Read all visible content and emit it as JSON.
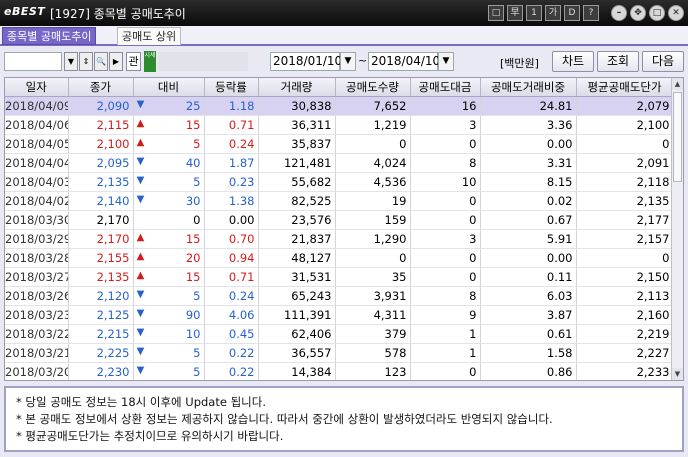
{
  "window": {
    "logo": "eBEST",
    "title": "[1927] 종목별 공매도추이",
    "buttons": [
      "□",
      "早",
      "1",
      "가",
      "D",
      "?"
    ]
  },
  "tabs": [
    {
      "label": "종목별 공매도추이",
      "active": true
    },
    {
      "label": "공매도 상위",
      "active": false
    }
  ],
  "toolbar": {
    "stock_code": "",
    "gwan_label": "관",
    "green_label": "시세",
    "date_from": "2018/01/10",
    "date_to": "2018/04/10",
    "tilde": "~",
    "unit": "[백만원]",
    "chart_button": "차트",
    "search_button": "조회",
    "next_button": "다음"
  },
  "table": {
    "columns": [
      "일자",
      "종가",
      "대비",
      "등락률",
      "거래량",
      "공매도수량",
      "공매도대금",
      "공매도거래비중",
      "평균공매도단가"
    ],
    "rows": [
      {
        "date": "2018/04/09",
        "close": "2,090",
        "dir": "down",
        "change": "25",
        "rate": "1.18",
        "volume": "30,838",
        "short_qty": "7,652",
        "short_amt": "16",
        "short_ratio": "24.81",
        "avg_price": "2,079"
      },
      {
        "date": "2018/04/06",
        "close": "2,115",
        "dir": "up",
        "change": "15",
        "rate": "0.71",
        "volume": "36,311",
        "short_qty": "1,219",
        "short_amt": "3",
        "short_ratio": "3.36",
        "avg_price": "2,100"
      },
      {
        "date": "2018/04/05",
        "close": "2,100",
        "dir": "up",
        "change": "5",
        "rate": "0.24",
        "volume": "35,837",
        "short_qty": "0",
        "short_amt": "0",
        "short_ratio": "0.00",
        "avg_price": "0"
      },
      {
        "date": "2018/04/04",
        "close": "2,095",
        "dir": "down",
        "change": "40",
        "rate": "1.87",
        "volume": "121,481",
        "short_qty": "4,024",
        "short_amt": "8",
        "short_ratio": "3.31",
        "avg_price": "2,091"
      },
      {
        "date": "2018/04/03",
        "close": "2,135",
        "dir": "down",
        "change": "5",
        "rate": "0.23",
        "volume": "55,682",
        "short_qty": "4,536",
        "short_amt": "10",
        "short_ratio": "8.15",
        "avg_price": "2,118"
      },
      {
        "date": "2018/04/02",
        "close": "2,140",
        "dir": "down",
        "change": "30",
        "rate": "1.38",
        "volume": "82,525",
        "short_qty": "19",
        "short_amt": "0",
        "short_ratio": "0.02",
        "avg_price": "2,135"
      },
      {
        "date": "2018/03/30",
        "close": "2,170",
        "dir": "flat",
        "change": "0",
        "rate": "0.00",
        "volume": "23,576",
        "short_qty": "159",
        "short_amt": "0",
        "short_ratio": "0.67",
        "avg_price": "2,177"
      },
      {
        "date": "2018/03/29",
        "close": "2,170",
        "dir": "up",
        "change": "15",
        "rate": "0.70",
        "volume": "21,837",
        "short_qty": "1,290",
        "short_amt": "3",
        "short_ratio": "5.91",
        "avg_price": "2,157"
      },
      {
        "date": "2018/03/28",
        "close": "2,155",
        "dir": "up",
        "change": "20",
        "rate": "0.94",
        "volume": "48,127",
        "short_qty": "0",
        "short_amt": "0",
        "short_ratio": "0.00",
        "avg_price": "0"
      },
      {
        "date": "2018/03/27",
        "close": "2,135",
        "dir": "up",
        "change": "15",
        "rate": "0.71",
        "volume": "31,531",
        "short_qty": "35",
        "short_amt": "0",
        "short_ratio": "0.11",
        "avg_price": "2,150"
      },
      {
        "date": "2018/03/26",
        "close": "2,120",
        "dir": "down",
        "change": "5",
        "rate": "0.24",
        "volume": "65,243",
        "short_qty": "3,931",
        "short_amt": "8",
        "short_ratio": "6.03",
        "avg_price": "2,113"
      },
      {
        "date": "2018/03/23",
        "close": "2,125",
        "dir": "down",
        "change": "90",
        "rate": "4.06",
        "volume": "111,391",
        "short_qty": "4,311",
        "short_amt": "9",
        "short_ratio": "3.87",
        "avg_price": "2,160"
      },
      {
        "date": "2018/03/22",
        "close": "2,215",
        "dir": "down",
        "change": "10",
        "rate": "0.45",
        "volume": "62,406",
        "short_qty": "379",
        "short_amt": "1",
        "short_ratio": "0.61",
        "avg_price": "2,219"
      },
      {
        "date": "2018/03/21",
        "close": "2,225",
        "dir": "down",
        "change": "5",
        "rate": "0.22",
        "volume": "36,557",
        "short_qty": "578",
        "short_amt": "1",
        "short_ratio": "1.58",
        "avg_price": "2,227"
      },
      {
        "date": "2018/03/20",
        "close": "2,230",
        "dir": "down",
        "change": "5",
        "rate": "0.22",
        "volume": "14,384",
        "short_qty": "123",
        "short_amt": "0",
        "short_ratio": "0.86",
        "avg_price": "2,233"
      }
    ]
  },
  "notes": [
    "* 당일 공매도 정보는 18시 이후에 Update 됩니다.",
    "* 본 공매도 정보에서 상환 정보는 제공하지 않습니다. 따라서 중간에 상환이 발생하였더라도 반영되지 않습니다.",
    "* 평균공매도단가는 추정치이므로 유의하시기 바랍니다."
  ],
  "colors": {
    "up": "#d21c1c",
    "down": "#2762c9",
    "accent": "#7766c6",
    "selected_row": "#d8d2f2"
  }
}
